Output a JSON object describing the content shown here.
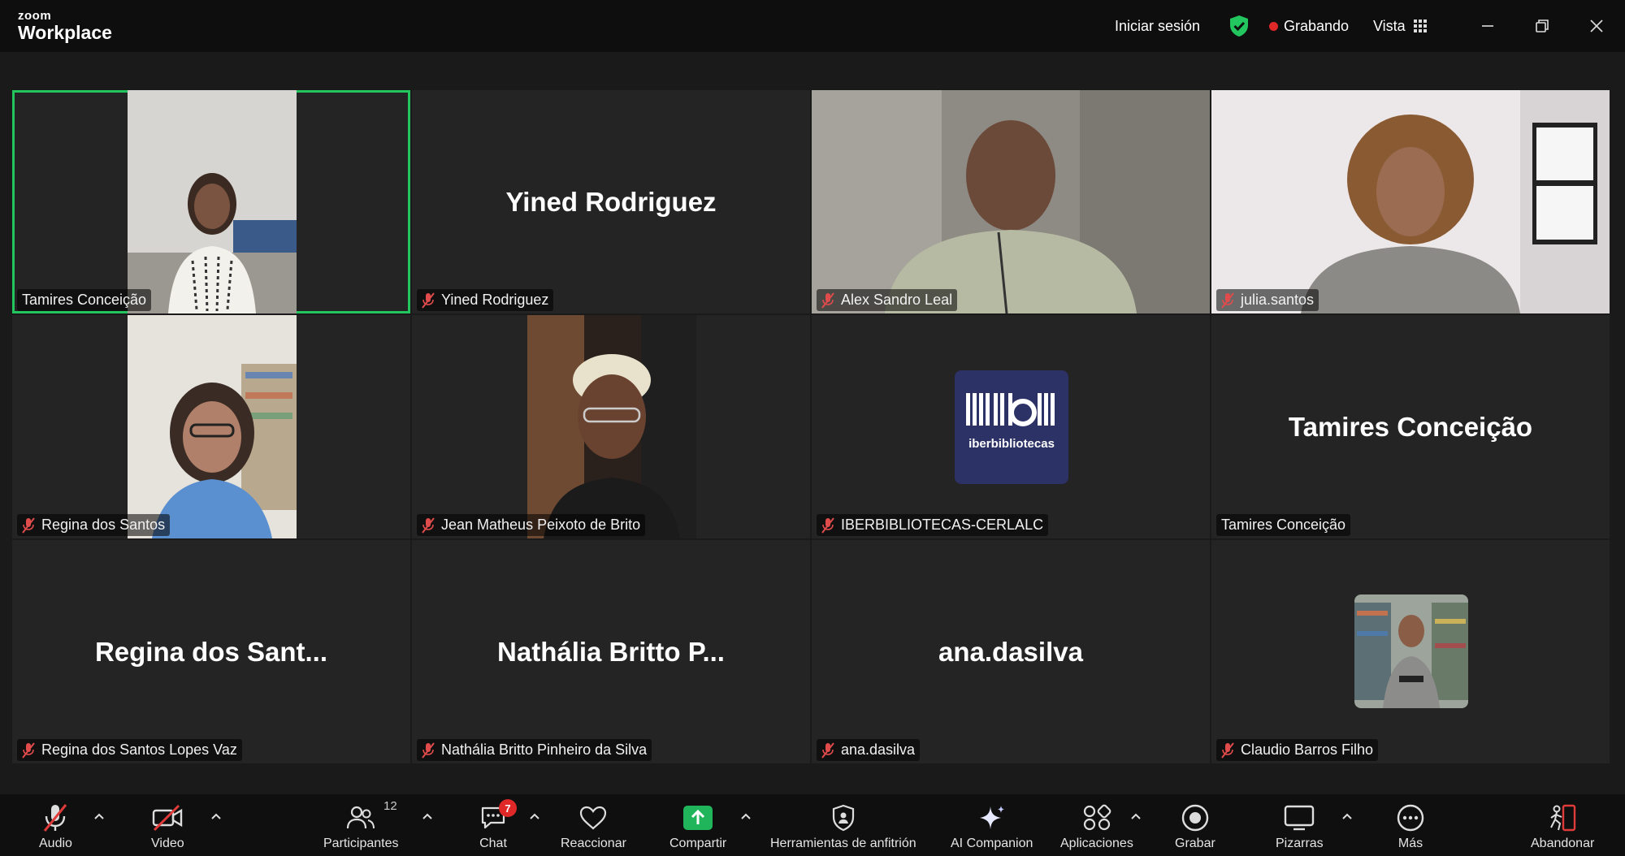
{
  "app": {
    "brand_top": "zoom",
    "brand_bottom": "Workplace"
  },
  "titlebar": {
    "signin": "Iniciar sesión",
    "recording": "Grabando",
    "view": "Vista"
  },
  "tiles": [
    {
      "label": "Tamires Conceição",
      "muted": false,
      "video": true,
      "active": true
    },
    {
      "label": "Yined Rodriguez",
      "big_name": "Yined Rodriguez",
      "muted": true,
      "video": false
    },
    {
      "label": "Alex Sandro Leal",
      "muted": true,
      "video": true
    },
    {
      "label": "julia.santos",
      "muted": true,
      "video": true
    },
    {
      "label": "Regina dos Santos",
      "muted": true,
      "video": true
    },
    {
      "label": "Jean Matheus Peixoto de Brito",
      "muted": true,
      "video": true
    },
    {
      "label": "IBERBIBLIOTECAS-CERLALC",
      "muted": true,
      "video": false,
      "logo_text": "iberbibliotecas"
    },
    {
      "label": "Tamires Conceição",
      "big_name": "Tamires Conceição",
      "muted": false,
      "video": false
    },
    {
      "label": "Regina dos Santos Lopes Vaz",
      "big_name": "Regina dos Sant...",
      "muted": true,
      "video": false
    },
    {
      "label": "Nathália Britto Pinheiro da Silva",
      "big_name": "Nathália Britto P...",
      "muted": true,
      "video": false
    },
    {
      "label": "ana.dasilva",
      "big_name": "ana.dasilva",
      "muted": true,
      "video": false
    },
    {
      "label": "Claudio Barros Filho",
      "muted": true,
      "video": false
    }
  ],
  "toolbar": {
    "audio": "Audio",
    "video": "Video",
    "participants": "Participantes",
    "participants_count": "12",
    "chat": "Chat",
    "chat_badge": "7",
    "react": "Reaccionar",
    "share": "Compartir",
    "host_tools": "Herramientas de anfitrión",
    "ai": "AI Companion",
    "apps": "Aplicaciones",
    "record": "Grabar",
    "whiteboards": "Pizarras",
    "more": "Más",
    "leave": "Abandonar"
  },
  "colors": {
    "accent_green": "#22c55e",
    "record_red": "#e02828",
    "share_green": "#20b55a",
    "tile_bg": "#242424"
  }
}
